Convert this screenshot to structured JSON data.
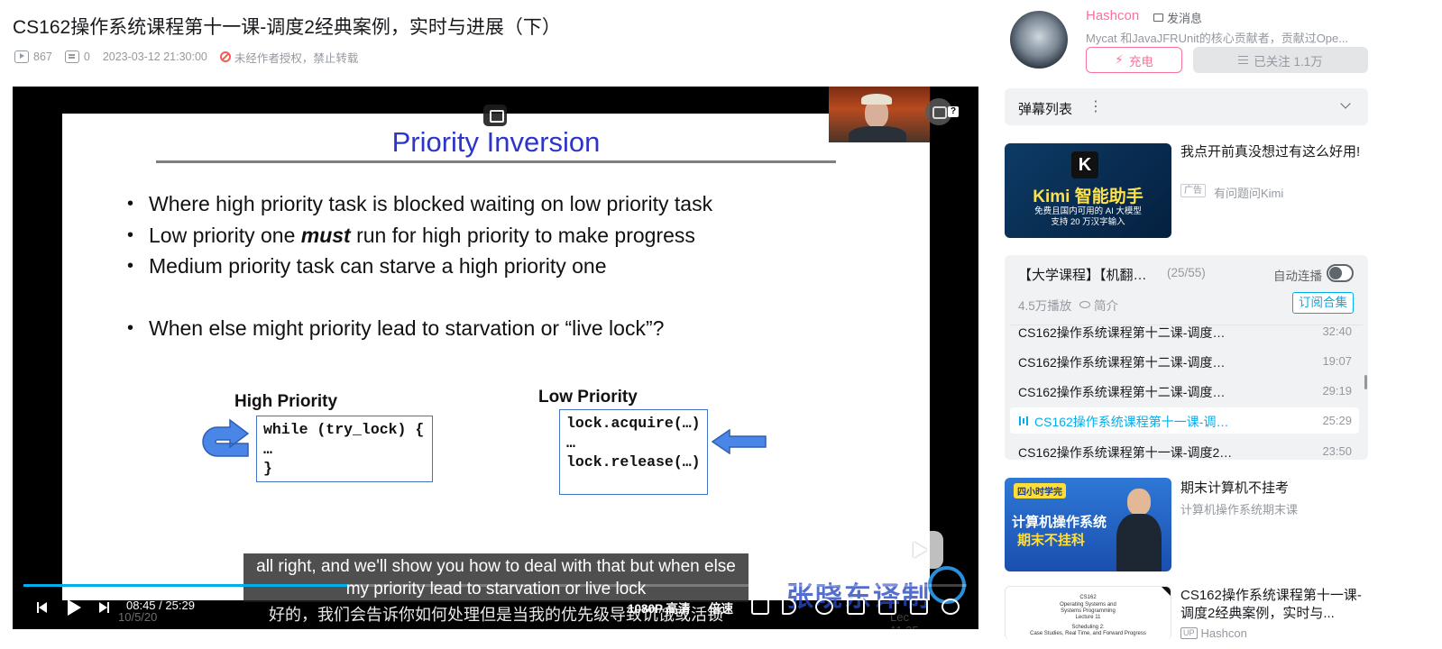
{
  "video": {
    "title": "CS162操作系统课程第十一课-调度2经典案例，实时与进展（下）",
    "views": "867",
    "danmaku_count": "0",
    "publish_time": "2023-03-12 21:30:00",
    "copyright_notice": "未经作者授权，禁止转载"
  },
  "slide": {
    "title": "Priority Inversion",
    "bullets_top": [
      "Where high priority task is blocked waiting on low priority task",
      "Low priority one must run for high priority to make progress",
      "Medium priority task can starve a high priority one"
    ],
    "bullets_bottom": [
      "When else might priority lead to starvation or “live lock”?"
    ],
    "high_label": "High Priority",
    "high_code": [
      "while (try_lock) {",
      "…",
      "}"
    ],
    "low_label": "Low Priority",
    "low_code": [
      "lock.acquire(…)",
      "…",
      "lock.release(…)"
    ],
    "date": "10/5/20",
    "lecture": "Lec 11.35"
  },
  "subtitles": {
    "english": "all right, and we'll show you how to deal with that but when else my priority lead to starvation or live lock",
    "chinese": "好的，我们会告诉你如何处理但是当我的优先级导致饥饿或活锁"
  },
  "watermark": "张晓东译制",
  "player": {
    "current_time": "08:45",
    "duration": "25:29",
    "time_separator": "/",
    "progress": 0.343,
    "quality": "1080P 高清",
    "speed": "倍速",
    "help_badge": "?"
  },
  "uploader": {
    "name": "Hashcon",
    "message_label": "发消息",
    "description": "Mycat 和JavaJFRUnit的核心贡献者，贡献过Ope...",
    "charge_label": "充电",
    "follow_label": "已关注 1.1万"
  },
  "danmaku_panel": {
    "title": "弹幕列表",
    "more": "⋮"
  },
  "ad": {
    "thumb_logo": "K",
    "thumb_title": "Kimi 智能助手",
    "thumb_line1": "免费且国内可用的 AI 大模型",
    "thumb_line2": "支持 20 万汉字输入",
    "title": "我点开前真没想过有这么好用!",
    "badge": "广告",
    "source": "有问题问Kimi"
  },
  "playlist": {
    "title": "【大学课程】【机翻…",
    "count": "(25/55)",
    "autoplay_label": "自动连播",
    "plays": "4.5万播放",
    "intro_label": "简介",
    "subscribe_label": "订阅合集",
    "episodes": [
      {
        "title": "CS162操作系统课程第十二课-调度…",
        "duration": "32:40"
      },
      {
        "title": "CS162操作系统课程第十二课-调度…",
        "duration": "19:07"
      },
      {
        "title": "CS162操作系统课程第十二课-调度…",
        "duration": "29:19"
      },
      {
        "title": "CS162操作系统课程第十一课-调…",
        "duration": "25:29"
      },
      {
        "title": "CS162操作系统课程第十一课-调度2…",
        "duration": "23:50"
      }
    ]
  },
  "recommendations": [
    {
      "title": "期末计算机不挂考",
      "subtitle": "计算机操作系统期末课",
      "thumb_badge": "四小时学完",
      "thumb_line1": "计算机操作系统",
      "thumb_line2": "期末不挂科"
    },
    {
      "title": "CS162操作系统课程第十一课-调度2经典案例，实时与...",
      "up_badge": "UP",
      "uploader": "Hashcon",
      "thumb_lines": [
        "CS162",
        "Operating Systems and",
        "Systems Programming",
        "Lecture 11",
        "",
        "Scheduling 2:",
        "Case Studies, Real Time, and Forward Progress"
      ]
    }
  ],
  "colors": {
    "accent_blue": "#00aeec",
    "brand_pink": "#fb7299",
    "slide_title_blue": "#2c35c9",
    "box_border": "#4472c4",
    "arrow_blue": "#4a86e8"
  }
}
